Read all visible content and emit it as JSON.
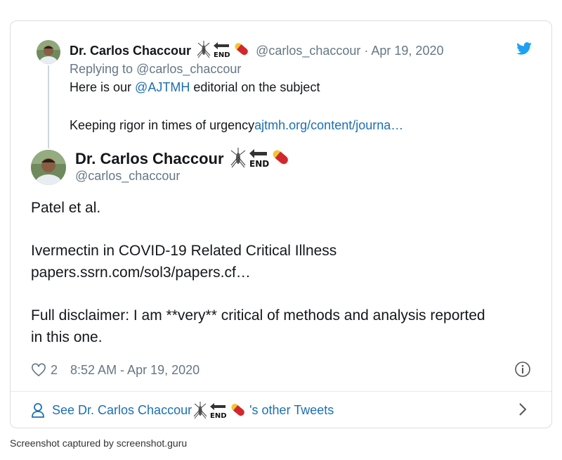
{
  "parent_tweet": {
    "author_name": "Dr. Carlos Chaccour",
    "handle_and_date": "@carlos_chaccour · Apr 19, 2020",
    "replying_to": "Replying to @carlos_chaccour",
    "line1_prefix": "Here is our ",
    "line1_mention": "@AJTMH",
    "line1_suffix": " editorial on the subject",
    "line2_text": "Keeping rigor in times of urgency",
    "line2_link": "ajtmh.org/content/journa…"
  },
  "main_tweet": {
    "author_name": "Dr. Carlos Chaccour",
    "handle": "@carlos_chaccour",
    "line1": "Patel et al.",
    "line2": "Ivermectin in COVID-19 Related Critical Illness",
    "line3_link": "papers.ssrn.com/sol3/papers.cf…",
    "line4": "Full disclaimer: I am **very** critical of methods and analysis reported",
    "line5": "in this one.",
    "like_count": "2",
    "timestamp": "8:52 AM - Apr 19, 2020"
  },
  "see_more": {
    "prefix": "See Dr. Carlos Chaccour ",
    "suffix": "'s other Tweets"
  },
  "emoji_sequence": [
    "mosquito-emoji",
    "end-arrow-emoji",
    "pill-emoji"
  ],
  "caption": "Screenshot captured by screenshot.guru",
  "colors": {
    "link": "#1b6fb5",
    "twitter_blue": "#1da1f2",
    "muted": "#657786",
    "border": "#d9dde1"
  }
}
